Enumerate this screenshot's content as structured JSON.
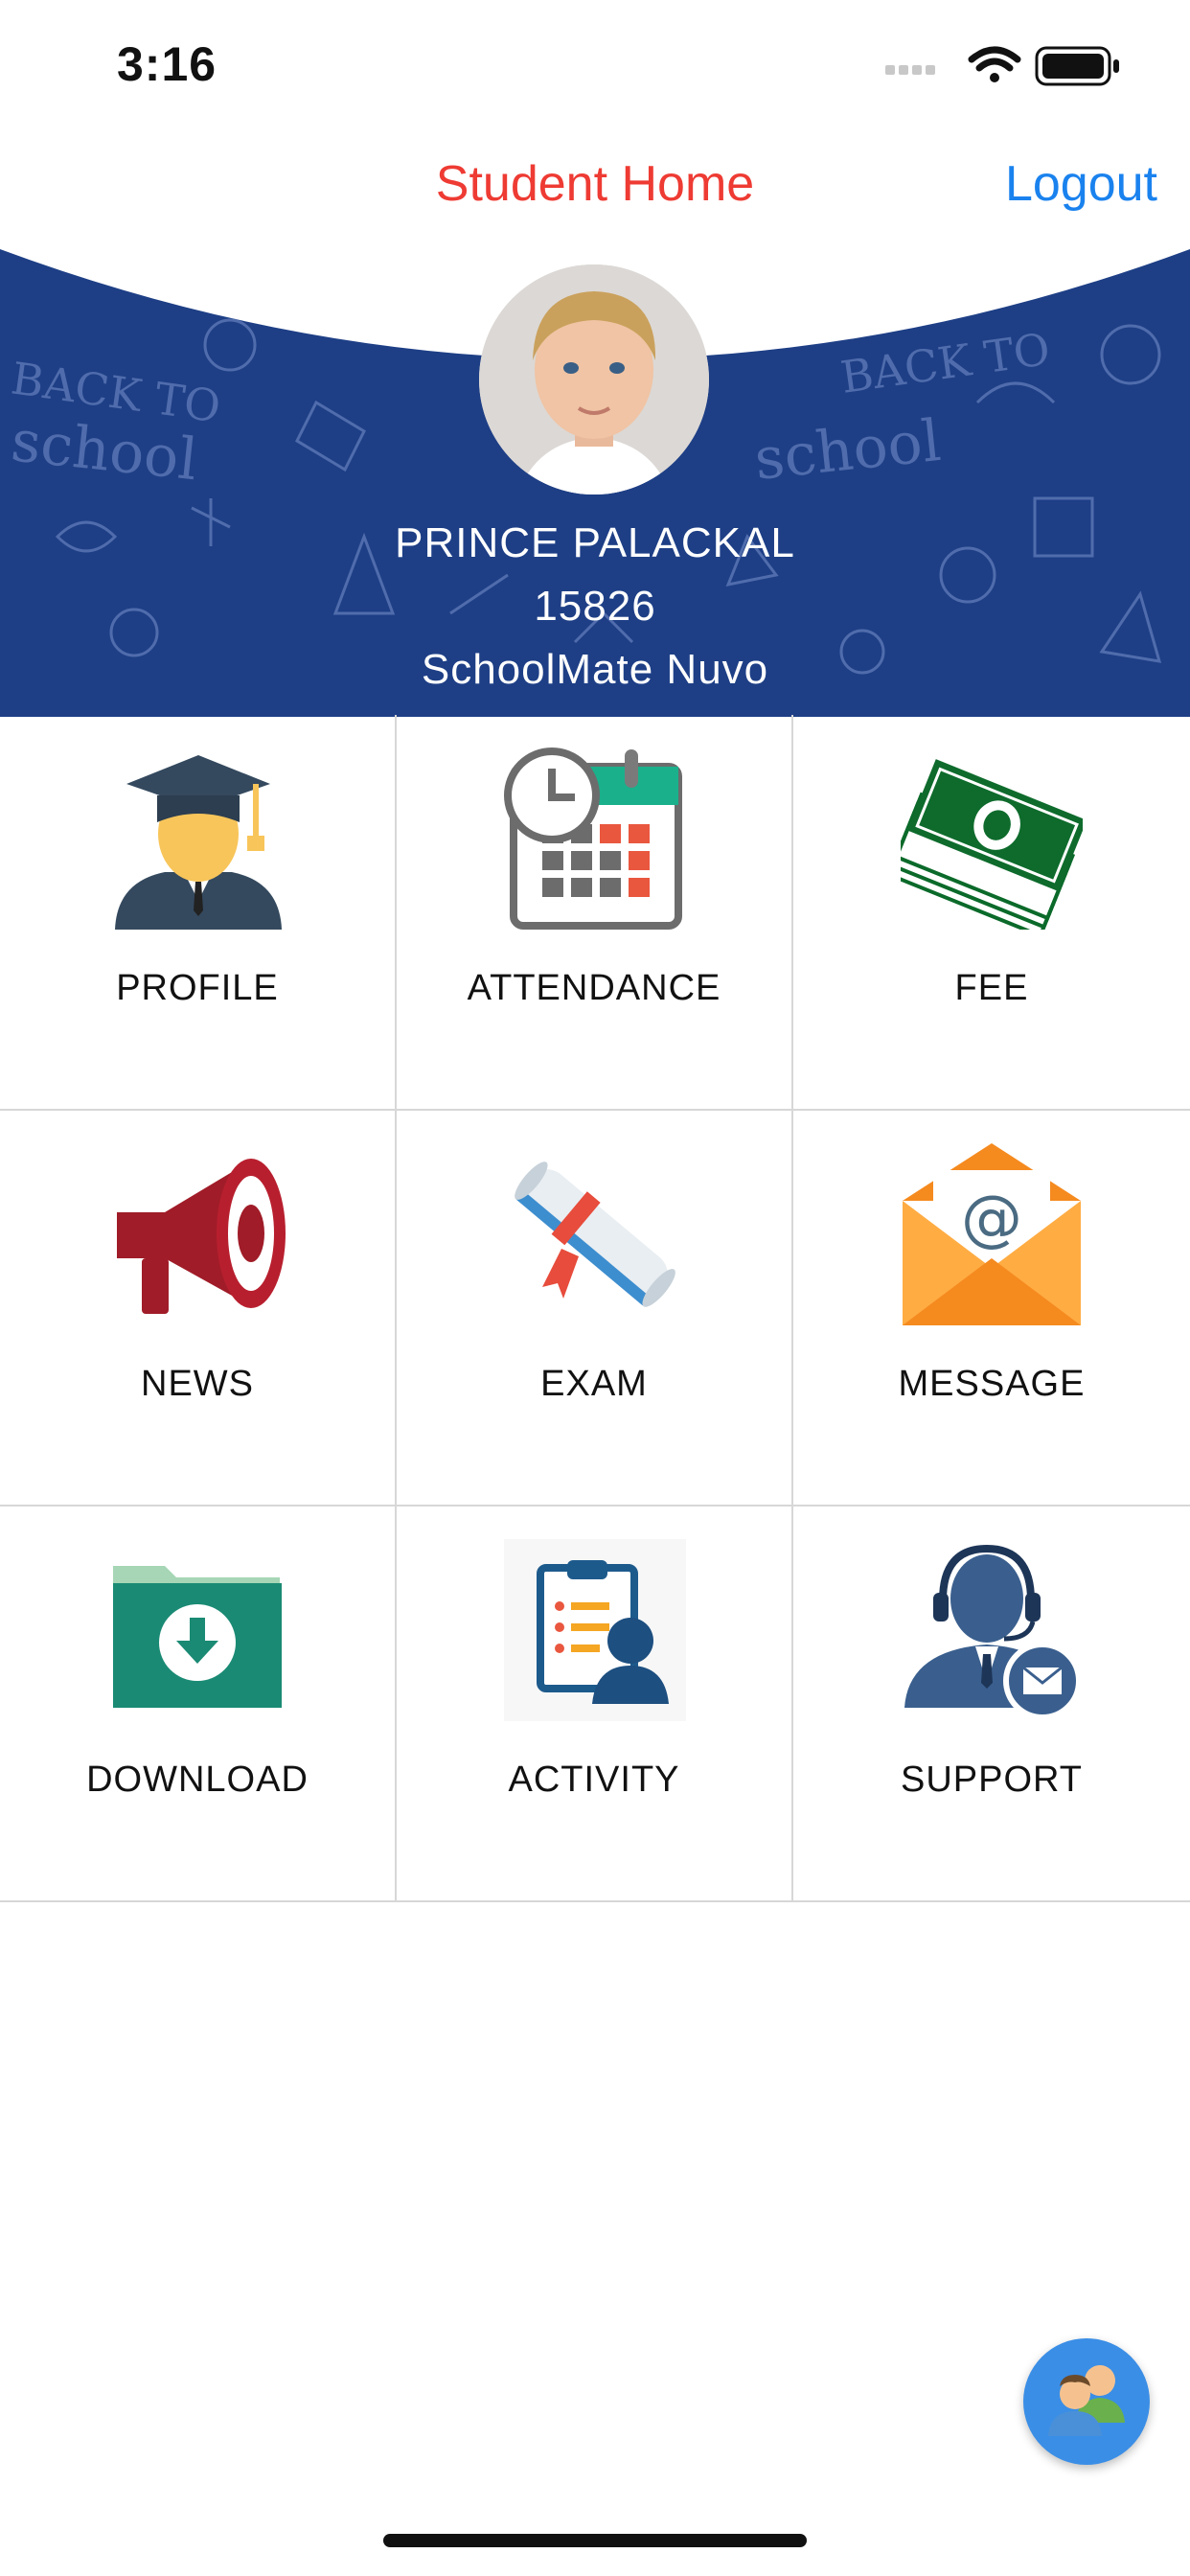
{
  "status_bar": {
    "time": "3:16",
    "icons": [
      "signal-icon",
      "wifi-icon",
      "battery-icon"
    ]
  },
  "nav": {
    "title": "Student Home",
    "logout_label": "Logout"
  },
  "colors": {
    "title_red": "#ee3b33",
    "link_blue": "#1a82ee",
    "banner_blue": "#1e3f86"
  },
  "student": {
    "name": "PRINCE PALACKAL",
    "id": "15826",
    "school": "SchoolMate Nuvo"
  },
  "menu": [
    {
      "label": "PROFILE",
      "icon": "graduate-icon"
    },
    {
      "label": "ATTENDANCE",
      "icon": "calendar-clock-icon"
    },
    {
      "label": "FEE",
      "icon": "money-stack-icon"
    },
    {
      "label": "NEWS",
      "icon": "megaphone-icon"
    },
    {
      "label": "EXAM",
      "icon": "diploma-scroll-icon"
    },
    {
      "label": "MESSAGE",
      "icon": "envelope-at-icon"
    },
    {
      "label": "DOWNLOAD",
      "icon": "download-folder-icon"
    },
    {
      "label": "ACTIVITY",
      "icon": "clipboard-person-icon"
    },
    {
      "label": "SUPPORT",
      "icon": "support-agent-icon"
    }
  ],
  "fab": {
    "icon": "users-icon"
  }
}
